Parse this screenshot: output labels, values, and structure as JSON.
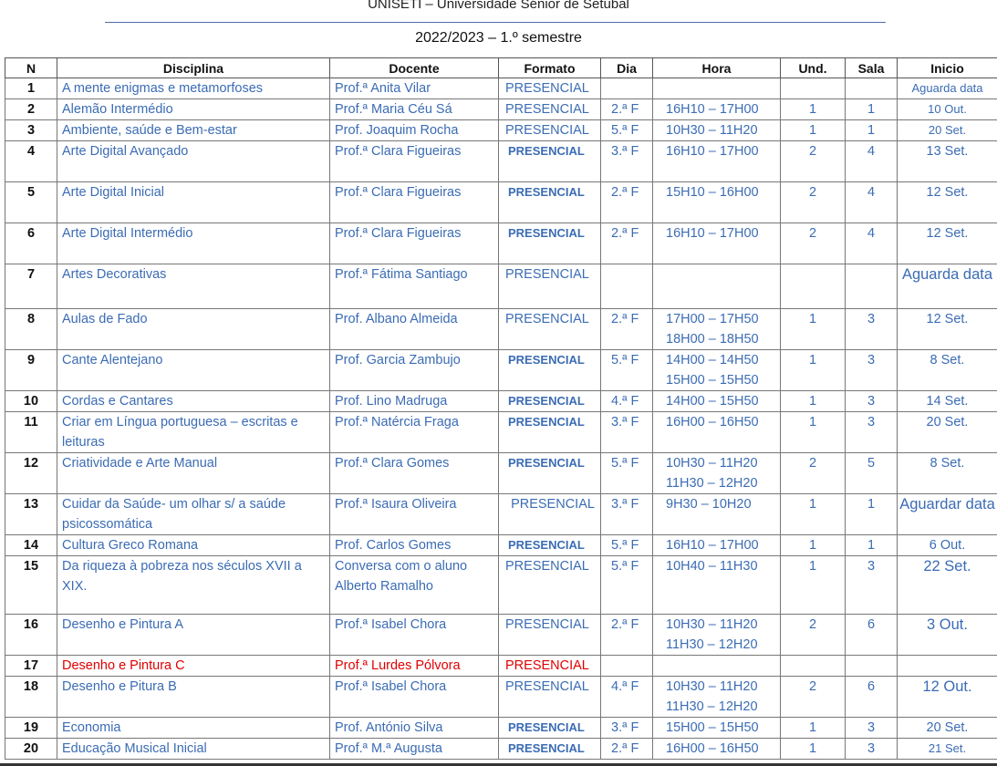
{
  "header": {
    "title": "UNISETI – Universidade Sénior de Setúbal",
    "semester": "2022/2023 – 1.º semestre"
  },
  "table": {
    "columns": [
      "N",
      "Disciplina",
      "Docente",
      "Formato",
      "Dia",
      "Hora",
      "Und.",
      "Sala",
      "Inicio"
    ],
    "rows": [
      {
        "n": "1",
        "disciplina": "A mente enigmas e metamorfoses",
        "docente": "Prof.ª Anita Vilar",
        "formato": "PRESENCIAL",
        "dia": "",
        "hora": "",
        "und": "",
        "sala": "",
        "inicio": "Aguarda data"
      },
      {
        "n": "2",
        "disciplina": "Alemão Intermédio",
        "docente": "Prof.ª Maria Céu Sá",
        "formato": "PRESENCIAL",
        "dia": "2.ª F",
        "hora": "16H10 – 17H00",
        "und": "1",
        "sala": "1",
        "inicio": "10 Out."
      },
      {
        "n": "3",
        "disciplina": "Ambiente, saúde e Bem-estar",
        "docente": "Prof. Joaquim Rocha",
        "formato": "PRESENCIAL",
        "dia": "5.ª F",
        "hora": "10H30 – 11H20",
        "und": "1",
        "sala": "1",
        "inicio": "20 Set."
      },
      {
        "n": "4",
        "disciplina": "Arte Digital Avançado",
        "docente": "Prof.ª Clara Figueiras",
        "formato": "PRESENCIAL",
        "dia": "3.ª F",
        "hora": "16H10 – 17H00",
        "und": "2",
        "sala": "4",
        "inicio": "13 Set."
      },
      {
        "n": "5",
        "disciplina": "Arte Digital Inicial",
        "docente": "Prof.ª Clara Figueiras",
        "formato": "PRESENCIAL",
        "dia": "2.ª F",
        "hora": "15H10 – 16H00",
        "und": "2",
        "sala": "4",
        "inicio": "12 Set."
      },
      {
        "n": "6",
        "disciplina": "Arte Digital Intermédio",
        "docente": "Prof.ª Clara Figueiras",
        "formato": "PRESENCIAL",
        "dia": "2.ª F",
        "hora": "16H10 – 17H00",
        "und": "2",
        "sala": "4",
        "inicio": "12 Set."
      },
      {
        "n": "7",
        "disciplina": "Artes Decorativas",
        "docente": "Prof.ª Fátima Santiago",
        "formato": "PRESENCIAL",
        "dia": "",
        "hora": "",
        "und": "",
        "sala": "",
        "inicio": "Aguarda data"
      },
      {
        "n": "8",
        "disciplina": "Aulas de Fado",
        "docente": "Prof. Albano Almeida",
        "formato": "PRESENCIAL",
        "dia": "2.ª F",
        "hora": "17H00 – 17H50\n18H00 – 18H50",
        "und": "1",
        "sala": "3",
        "inicio": "12 Set."
      },
      {
        "n": "9",
        "disciplina": "Cante Alentejano",
        "docente": "Prof. Garcia Zambujo",
        "formato": "PRESENCIAL",
        "dia": "5.ª F",
        "hora": "14H00 – 14H50\n15H00 – 15H50",
        "und": "1",
        "sala": "3",
        "inicio": "8 Set."
      },
      {
        "n": "10",
        "disciplina": "Cordas e Cantares",
        "docente": "Prof. Lino Madruga",
        "formato": "PRESENCIAL",
        "dia": "4.ª F",
        "hora": "14H00 – 15H50",
        "und": "1",
        "sala": "3",
        "inicio": "14 Set."
      },
      {
        "n": "11",
        "disciplina": "Criar em Língua portuguesa – escritas e leituras",
        "docente": "Prof.ª Natércia Fraga",
        "formato": "PRESENCIAL",
        "dia": "3.ª F",
        "hora": "16H00 – 16H50",
        "und": "1",
        "sala": "3",
        "inicio": "20 Set."
      },
      {
        "n": "12",
        "disciplina": "Criatividade e Arte Manual",
        "docente": "Prof.ª Clara Gomes",
        "formato": "PRESENCIAL",
        "dia": "5.ª F",
        "hora": "10H30 – 11H20\n11H30 – 12H20",
        "und": "2",
        "sala": "5",
        "inicio": "8 Set."
      },
      {
        "n": "13",
        "disciplina": "Cuidar da Saúde- um olhar s/ a saúde psicossomática",
        "docente": "Prof.ª Isaura Oliveira",
        "formato": "PRESENCIAL",
        "dia": "3.ª F",
        "hora": "9H30 – 10H20",
        "und": "1",
        "sala": "1",
        "inicio": "Aguardar data"
      },
      {
        "n": "14",
        "disciplina": "Cultura Greco Romana",
        "docente": "Prof. Carlos Gomes",
        "formato": "PRESENCIAL",
        "dia": "5.ª F",
        "hora": "16H10 – 17H00",
        "und": "1",
        "sala": "1",
        "inicio": "6 Out."
      },
      {
        "n": "15",
        "disciplina": "Da riqueza à pobreza nos séculos XVII a XIX.",
        "docente": "Conversa com o aluno Alberto Ramalho",
        "formato": "PRESENCIAL",
        "dia": "5.ª F",
        "hora": "10H40 – 11H30",
        "und": "1",
        "sala": "3",
        "inicio": "22 Set."
      },
      {
        "n": "16",
        "disciplina": "Desenho e Pintura A",
        "docente": "Prof.ª Isabel Chora",
        "formato": "PRESENCIAL",
        "dia": "2.ª F",
        "hora": "10H30 – 11H20\n11H30 – 12H20",
        "und": "2",
        "sala": "6",
        "inicio": "3 Out."
      },
      {
        "n": "17",
        "disciplina": "Desenho e Pintura C",
        "docente": "Prof.ª Lurdes Pólvora",
        "formato": "PRESENCIAL",
        "dia": "",
        "hora": "",
        "und": "",
        "sala": "",
        "inicio": ""
      },
      {
        "n": "18",
        "disciplina": "Desenho e Pitura B",
        "docente": "Prof.ª Isabel Chora",
        "formato": "PRESENCIAL",
        "dia": "4.ª F",
        "hora": "10H30 – 11H20\n11H30 – 12H20",
        "und": "2",
        "sala": "6",
        "inicio": "12 Out."
      },
      {
        "n": "19",
        "disciplina": "Economia",
        "docente": "Prof. António Silva",
        "formato": "PRESENCIAL",
        "dia": "3.ª F",
        "hora": "15H00 – 15H50",
        "und": "1",
        "sala": "3",
        "inicio": "20 Set."
      },
      {
        "n": "20",
        "disciplina": "Educação Musical Inicial",
        "docente": "Prof.ª M.ª Augusta",
        "formato": "PRESENCIAL",
        "dia": "2.ª F",
        "hora": "16H00 – 16H50",
        "und": "1",
        "sala": "3",
        "inicio": "21 Set."
      }
    ]
  }
}
